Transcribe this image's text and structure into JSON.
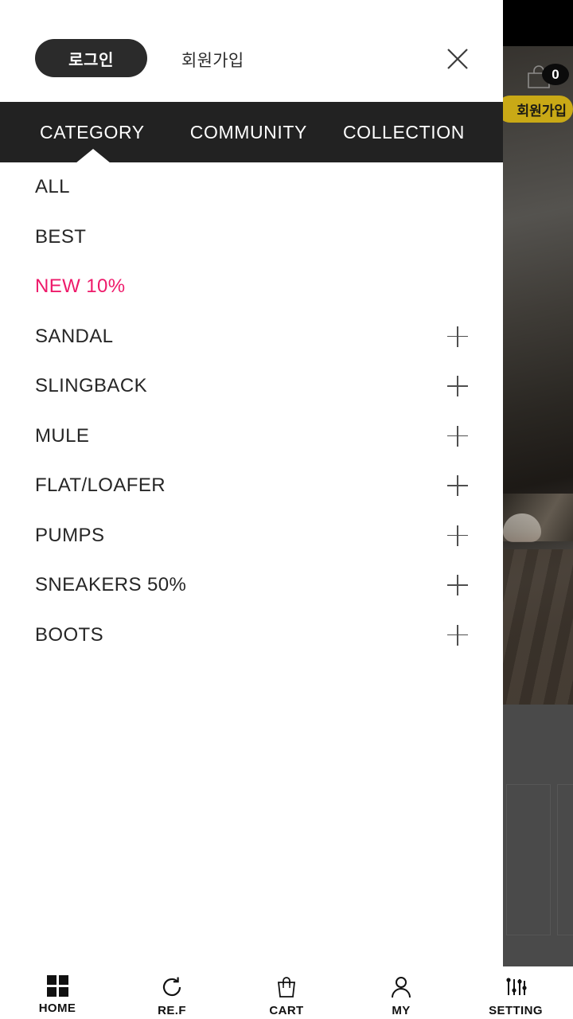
{
  "background": {
    "cart_badge_count": "0",
    "join_pill_label": "회원가입",
    "cart_icon": "shopping-bag-icon"
  },
  "drawer": {
    "login_button_label": "로그인",
    "join_link_label": "회원가입",
    "close_icon": "close-icon",
    "tabs": [
      {
        "label": "CATEGORY",
        "active": true
      },
      {
        "label": "COMMUNITY",
        "active": false
      },
      {
        "label": "COLLECTION",
        "active": false
      }
    ],
    "categories": [
      {
        "label": "ALL",
        "expandable": false,
        "accent": false
      },
      {
        "label": "BEST",
        "expandable": false,
        "accent": false
      },
      {
        "label": "NEW 10%",
        "expandable": false,
        "accent": true
      },
      {
        "label": "SANDAL",
        "expandable": true,
        "accent": false
      },
      {
        "label": "SLINGBACK",
        "expandable": true,
        "accent": false
      },
      {
        "label": "MULE",
        "expandable": true,
        "accent": false
      },
      {
        "label": "FLAT/LOAFER",
        "expandable": true,
        "accent": false
      },
      {
        "label": "PUMPS",
        "expandable": true,
        "accent": false
      },
      {
        "label": "SNEAKERS 50%",
        "expandable": true,
        "accent": false
      },
      {
        "label": "BOOTS",
        "expandable": true,
        "accent": false
      }
    ]
  },
  "bottom_nav": [
    {
      "label": "HOME",
      "icon": "grid-icon"
    },
    {
      "label": "RE.F",
      "icon": "refresh-icon"
    },
    {
      "label": "CART",
      "icon": "shopping-bag-icon"
    },
    {
      "label": "MY",
      "icon": "person-icon"
    },
    {
      "label": "SETTING",
      "icon": "sliders-icon"
    }
  ],
  "colors": {
    "accent_pink": "#ee1a6a",
    "tabbar_dark": "#222222",
    "login_pill": "#2b2b2b",
    "join_pill_yellow": "#c9a916",
    "overlay_grey": "#4a4a4a"
  }
}
